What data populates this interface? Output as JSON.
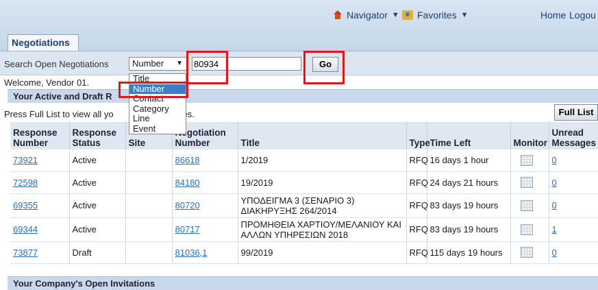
{
  "header": {
    "navigator_label": "Navigator",
    "favorites_label": "Favorites",
    "home_label": "Home",
    "logout_label": "Logou"
  },
  "tab": {
    "label": "Negotiations"
  },
  "search": {
    "label": "Search Open Negotiations",
    "selected_option": "Number",
    "value": "80934",
    "go_label": "Go",
    "options": [
      "Title",
      "Number",
      "Contact",
      "Category",
      "Line",
      "Event"
    ]
  },
  "welcome": "Welcome, Vendor 01.",
  "active_section": {
    "title": "Your Active and Draft R",
    "press_text_a": "Press Full List to view all yo",
    "press_text_b": "responses.",
    "full_list_label": "Full List"
  },
  "table": {
    "headers": {
      "response_number": "Response Number",
      "response_status": "Response Status",
      "site": "Site",
      "negotiation_number": "Negotiation Number",
      "title": "Title",
      "type": "Type",
      "time_left": "Time Left",
      "monitor": "Monitor",
      "unread": "Unread Messages"
    },
    "rows": [
      {
        "response_number": "73921",
        "status": "Active",
        "negotiation_number": "86618",
        "title": "1/2019",
        "type": "RFQ",
        "time_left": "16 days 1 hour",
        "unread": "0"
      },
      {
        "response_number": "72598",
        "status": "Active",
        "negotiation_number": "84180",
        "title": "19/2019",
        "type": "RFQ",
        "time_left": "24 days 21 hours",
        "unread": "0"
      },
      {
        "response_number": "69355",
        "status": "Active",
        "negotiation_number": "80720",
        "title": "ΥΠΟΔΕΙΓΜΑ 3 (ΣΕΝΑΡΙΟ 3) ΔΙΑΚΗΡΥΞΗΣ 264/2014",
        "type": "RFQ",
        "time_left": "83 days 19 hours",
        "unread": "0"
      },
      {
        "response_number": "69344",
        "status": "Active",
        "negotiation_number": "80717",
        "title": "ΠΡΟΜΗΘΕΙΑ ΧΑΡΤΙΟΥ/ΜΕΛΑΝΙΟΥ ΚΑΙ ΑΛΛΩΝ ΥΠΗΡΕΣΙΩΝ 2018",
        "type": "RFQ",
        "time_left": "83 days 19 hours",
        "unread": "1"
      },
      {
        "response_number": "73877",
        "status": "Draft",
        "negotiation_number": "81036,1",
        "title": "99/2019",
        "type": "RFQ",
        "time_left": "115 days 19 hours",
        "unread": "0"
      }
    ]
  },
  "invitations_section": {
    "title": "Your Company's Open Invitations"
  },
  "colors": {
    "highlight": "#e5141b",
    "link": "#2a6ebb",
    "selected_option_bg": "#3d7cc9"
  },
  "icons": {
    "navigator": "home-icon",
    "favorites": "favorites-icon",
    "monitor": "monitor-icon"
  }
}
